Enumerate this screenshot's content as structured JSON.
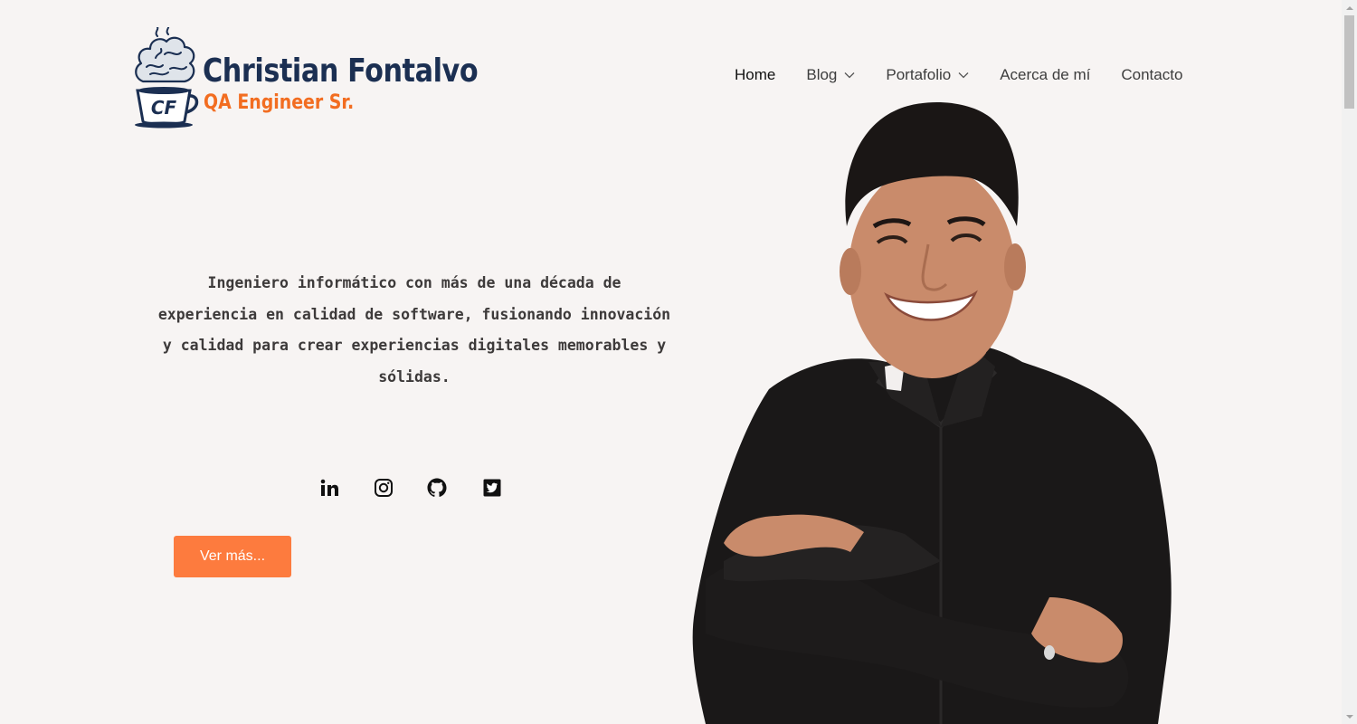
{
  "brand": {
    "name": "Christian Fontalvo",
    "tagline": "QA Engineer Sr.",
    "monogram": "CF",
    "name_color": "#1b2f52",
    "tagline_color": "#f26d21"
  },
  "nav": {
    "items": [
      {
        "label": "Home",
        "active": true,
        "has_dropdown": false
      },
      {
        "label": "Blog",
        "active": false,
        "has_dropdown": true
      },
      {
        "label": "Portafolio",
        "active": false,
        "has_dropdown": true
      },
      {
        "label": "Acerca de mí",
        "active": false,
        "has_dropdown": false
      },
      {
        "label": "Contacto",
        "active": false,
        "has_dropdown": false
      }
    ]
  },
  "hero": {
    "lines": [
      "Ingeniero informático con más de una década de",
      "experiencia en calidad de software, fusionando innovación",
      "y calidad para crear experiencias digitales memorables y",
      "sólidas."
    ]
  },
  "social": {
    "icons": [
      "linkedin-icon",
      "instagram-icon",
      "github-icon",
      "twitter-icon"
    ]
  },
  "cta": {
    "label": "Ver más...",
    "color": "#fd7b3e"
  },
  "theme": {
    "background": "#f7f4f3",
    "text": "#3d3a3a"
  }
}
